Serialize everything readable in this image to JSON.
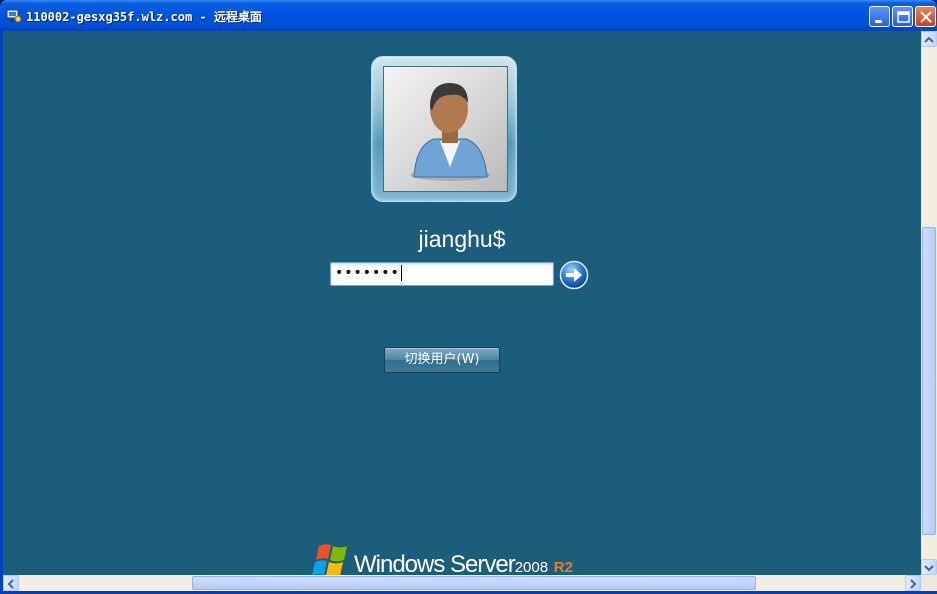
{
  "window": {
    "title": "110002-gesxg35f.wlz.com - 远程桌面",
    "icon": "remote-desktop-icon",
    "controls": [
      "minimize-icon",
      "maximize-icon",
      "close-icon"
    ]
  },
  "login": {
    "username": "jianghu$",
    "password_mask": "•••••••",
    "submit_icon": "arrow-right-icon",
    "switch_user_label": "切换用户(W)"
  },
  "branding": {
    "product": "Windows Server",
    "year": "2008",
    "edition": "R2",
    "logo": "windows-flag-icon"
  },
  "colors": {
    "background": "#1b5e7b",
    "titlebar": "#0054e3",
    "edition_accent": "#e77a2d"
  }
}
